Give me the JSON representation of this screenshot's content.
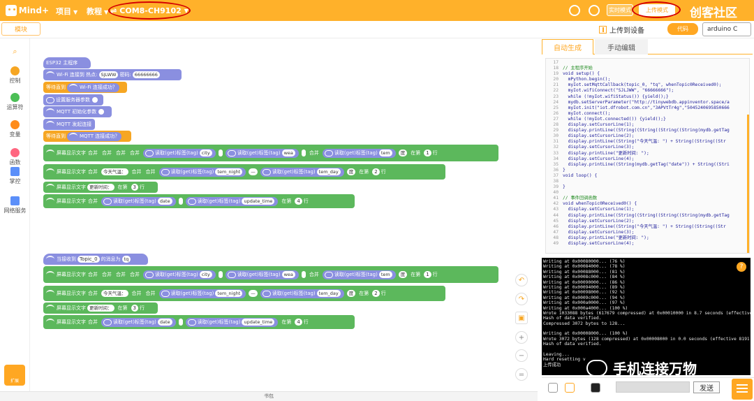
{
  "app": {
    "logo": "Mind+",
    "menu": {
      "project": "项目",
      "tutorial": "教程"
    },
    "port": "COM8-CH9102",
    "modes": {
      "realtime": "实时模式",
      "upload": "上传模式"
    },
    "watermark_top": "创客社区"
  },
  "toolbar": {
    "modules": "模块",
    "upload_device": "上传到设备",
    "code_btn": "代码",
    "board": "arduino C"
  },
  "sidebar": [
    {
      "label": "控制",
      "color": "#f6a623"
    },
    {
      "label": "运算符",
      "color": "#4cbf56"
    },
    {
      "label": "变量",
      "color": "#ff8c1a"
    },
    {
      "label": "函数",
      "color": "#ff6680"
    },
    {
      "label": "掌控",
      "color": "#5b8ff9"
    },
    {
      "label": "网络服务",
      "color": "#5b8ff9"
    }
  ],
  "expand_label": "扩展",
  "bottom_label": "书包",
  "blocks": {
    "esp32_start": "ESP32 主程序",
    "wifi_connect": "Wi-Fi 连接到 热点:",
    "wifi_ssid": "SJLWW",
    "wifi_pwd_lbl": "密码:",
    "wifi_pwd": "66666666",
    "wait_until": "等待直到",
    "wifi_ok": "Wi-Fi 连接成功？",
    "set_server": "设置服务器参数",
    "mqtt_init": "MQTT 初始化参数",
    "mqtt_connect": "MQTT 发起连接",
    "mqtt_ok": "MQTT 连接成功？",
    "screen_show": "屏幕显示文字",
    "merge": "合并",
    "read_tag": "读取(get)标签(tag)",
    "city": "city",
    "wea": "wea",
    "tem": "tem",
    "deg": "度",
    "space": " ",
    "tem_night": "tem_night",
    "dash": "—",
    "tem_day": "tem_day",
    "today": "今天气温：",
    "update_time_lbl": "更新时间：",
    "date": "date",
    "update_time": "update_time",
    "at_line": "在第",
    "row": "行",
    "n1": "1",
    "n2": "2",
    "n3": "3",
    "n4": "4",
    "on_receive": "当接收到",
    "topic": "Topic_0",
    "msg_is": "的消息为",
    "tq": "tq"
  },
  "tabs": {
    "auto": "自动生成",
    "manual": "手动编辑"
  },
  "code": [
    {
      "n": "17",
      "t": ""
    },
    {
      "n": "18",
      "t": "// 主程序开始"
    },
    {
      "n": "19",
      "t": "void setup() {"
    },
    {
      "n": "20",
      "t": "  mPython.begin();"
    },
    {
      "n": "21",
      "t": "  myIot.setMqttCallback(topic_0, \"tq\", whenTopic0Received0);"
    },
    {
      "n": "22",
      "t": "  myIot.wifiConnect(\"SJLJWW\", \"66666666\");"
    },
    {
      "n": "23",
      "t": "  while (!myIot.wifiStatus()) {yield();}"
    },
    {
      "n": "24",
      "t": "  mydb.setServerParameter(\"http://tinywebdb.appinventor.space/a"
    },
    {
      "n": "25",
      "t": "  myIot.init(\"iot.dfrobot.com.cn\",\"3APVtTr4g\",\"5045240695850666"
    },
    {
      "n": "26",
      "t": "  myIot.connect();"
    },
    {
      "n": "27",
      "t": "  while (!myIot.connected()) {yield();}"
    },
    {
      "n": "28",
      "t": "  display.setCursorLine(1);"
    },
    {
      "n": "29",
      "t": "  display.printLine((String((String((String((String(mydb.getTag"
    },
    {
      "n": "30",
      "t": "  display.setCursorLine(2);"
    },
    {
      "n": "31",
      "t": "  display.printLine((String(\"今天气温: \") + String((String((Str"
    },
    {
      "n": "32",
      "t": "  display.setCursorLine(3);"
    },
    {
      "n": "33",
      "t": "  display.printLine(\"更新时间: \");"
    },
    {
      "n": "34",
      "t": "  display.setCursorLine(4);"
    },
    {
      "n": "35",
      "t": "  display.printLine((String(mydb.getTag(\"date\")) + String((Stri"
    },
    {
      "n": "36",
      "t": "}"
    },
    {
      "n": "37",
      "t": "void loop() {"
    },
    {
      "n": "38",
      "t": ""
    },
    {
      "n": "39",
      "t": "}"
    },
    {
      "n": "40",
      "t": ""
    },
    {
      "n": "41",
      "t": "// 事件回调函数"
    },
    {
      "n": "42",
      "t": "void whenTopic0Received0() {"
    },
    {
      "n": "43",
      "t": "  display.setCursorLine(1);"
    },
    {
      "n": "44",
      "t": "  display.printLine((String((String((String((String(mydb.getTag"
    },
    {
      "n": "45",
      "t": "  display.setCursorLine(2);"
    },
    {
      "n": "46",
      "t": "  display.printLine((String(\"今天气温: \") + String((String((Str"
    },
    {
      "n": "47",
      "t": "  display.setCursorLine(3);"
    },
    {
      "n": "48",
      "t": "  display.printLine(\"更新时间: \");"
    },
    {
      "n": "49",
      "t": "  display.setCursorLine(4);"
    }
  ],
  "terminal": [
    "Writing at 0x00080000... (76 %)",
    "Writing at 0x00084000... (78 %)",
    "Writing at 0x00088000... (81 %)",
    "Writing at 0x0008c000... (84 %)",
    "Writing at 0x00090000... (86 %)",
    "Writing at 0x00094000... (89 %)",
    "Writing at 0x00098000... (92 %)",
    "Writing at 0x0009c000... (94 %)",
    "Writing at 0x000a0000... (97 %)",
    "Writing at 0x000a4000... (100 %)",
    "Wrote 1033088 bytes (617679 compressed) at 0x00010000 in 8.7 seconds (effective",
    "Hash of data verified.",
    "Compressed 3072 bytes to 128...",
    "",
    "Writing at 0x00008000... (100 %)",
    "Wrote 3072 bytes (128 compressed) at 0x00008000 in 0.0 seconds (effective 8191.",
    "Hash of data verified.",
    "",
    "Leaving...",
    "Hard resetting v",
    "上传成功"
  ],
  "watermark_bottom": "手机连接万物",
  "serial": {
    "send": "发送",
    "input": ""
  }
}
